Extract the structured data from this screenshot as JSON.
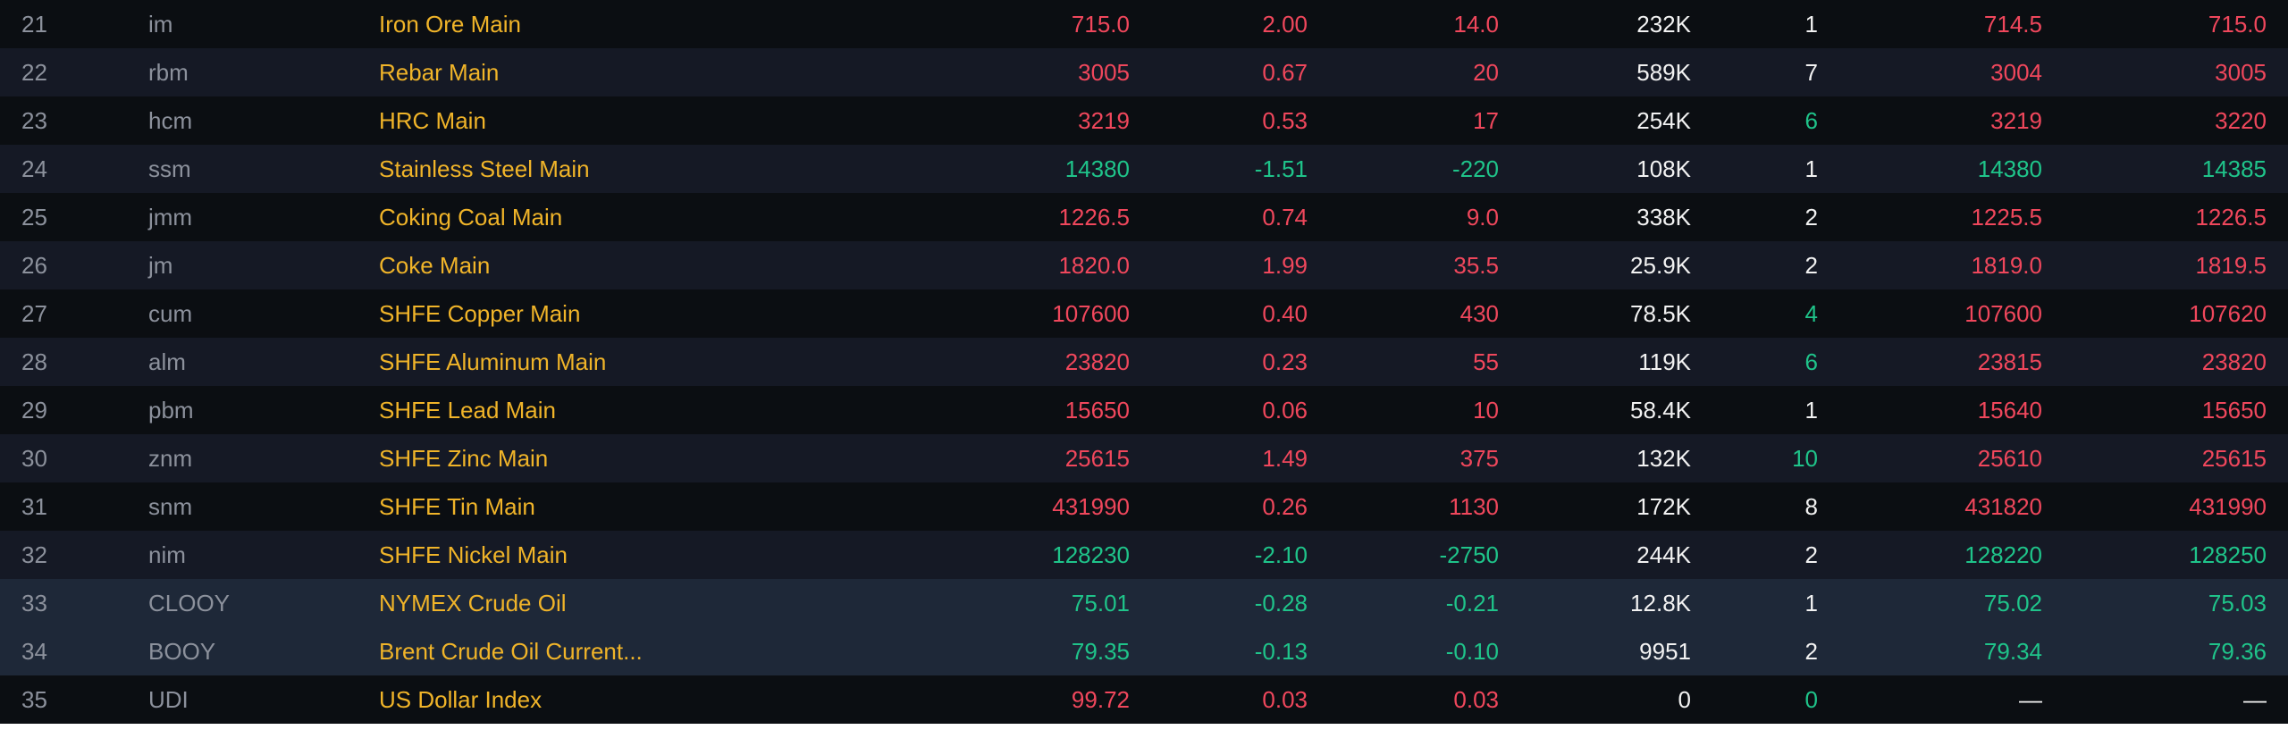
{
  "colors": {
    "up": "#f0475c",
    "down": "#1fc48a",
    "neutral": "#f2f2f2",
    "name": "#f0b429",
    "muted": "#8c919c",
    "row_odd": "#0b0e12",
    "row_even": "#151925",
    "row_highlight": "#1e2838"
  },
  "rows": [
    {
      "idx": "21",
      "code": "im",
      "name": "Iron Ore Main",
      "last": "715.0",
      "pct": "-",
      "pct_v": "2.00",
      "chg": "14.0",
      "vol": "232K",
      "cur": "1",
      "bid": "714.5",
      "ask": "715.0",
      "dir": "up",
      "cur_dir": "flat",
      "bg": "odd"
    },
    {
      "idx": "22",
      "code": "rbm",
      "name": "Rebar Main",
      "last": "3005",
      "pct_v": "0.67",
      "chg": "20",
      "vol": "589K",
      "cur": "7",
      "bid": "3004",
      "ask": "3005",
      "dir": "up",
      "cur_dir": "flat",
      "bg": "even"
    },
    {
      "idx": "23",
      "code": "hcm",
      "name": "HRC Main",
      "last": "3219",
      "pct_v": "0.53",
      "chg": "17",
      "vol": "254K",
      "cur": "6",
      "bid": "3219",
      "ask": "3220",
      "dir": "up",
      "cur_dir": "down",
      "bg": "odd"
    },
    {
      "idx": "24",
      "code": "ssm",
      "name": "Stainless Steel Main",
      "last": "14380",
      "pct_v": "-1.51",
      "chg": "-220",
      "vol": "108K",
      "cur": "1",
      "bid": "14380",
      "ask": "14385",
      "dir": "down",
      "cur_dir": "flat",
      "bg": "even"
    },
    {
      "idx": "25",
      "code": "jmm",
      "name": "Coking Coal Main",
      "last": "1226.5",
      "pct_v": "0.74",
      "chg": "9.0",
      "vol": "338K",
      "cur": "2",
      "bid": "1225.5",
      "ask": "1226.5",
      "dir": "up",
      "cur_dir": "flat",
      "bg": "odd"
    },
    {
      "idx": "26",
      "code": "jm",
      "name": "Coke Main",
      "last": "1820.0",
      "pct_v": "1.99",
      "chg": "35.5",
      "vol": "25.9K",
      "cur": "2",
      "bid": "1819.0",
      "ask": "1819.5",
      "dir": "up",
      "cur_dir": "flat",
      "bg": "even"
    },
    {
      "idx": "27",
      "code": "cum",
      "name": "SHFE Copper Main",
      "last": "107600",
      "pct_v": "0.40",
      "chg": "430",
      "vol": "78.5K",
      "cur": "4",
      "bid": "107600",
      "ask": "107620",
      "dir": "up",
      "cur_dir": "down",
      "bg": "odd"
    },
    {
      "idx": "28",
      "code": "alm",
      "name": "SHFE Aluminum Main",
      "last": "23820",
      "pct_v": "0.23",
      "chg": "55",
      "vol": "119K",
      "cur": "6",
      "bid": "23815",
      "ask": "23820",
      "dir": "up",
      "cur_dir": "down",
      "bg": "even"
    },
    {
      "idx": "29",
      "code": "pbm",
      "name": "SHFE Lead Main",
      "last": "15650",
      "pct_v": "0.06",
      "chg": "10",
      "vol": "58.4K",
      "cur": "1",
      "bid": "15640",
      "ask": "15650",
      "dir": "up",
      "cur_dir": "flat",
      "bg": "odd"
    },
    {
      "idx": "30",
      "code": "znm",
      "name": "SHFE Zinc Main",
      "last": "25615",
      "pct_v": "1.49",
      "chg": "375",
      "vol": "132K",
      "cur": "10",
      "bid": "25610",
      "ask": "25615",
      "dir": "up",
      "cur_dir": "down",
      "bg": "even"
    },
    {
      "idx": "31",
      "code": "snm",
      "name": "SHFE Tin Main",
      "last": "431990",
      "pct_v": "0.26",
      "chg": "1130",
      "vol": "172K",
      "cur": "8",
      "bid": "431820",
      "ask": "431990",
      "dir": "up",
      "cur_dir": "flat",
      "bg": "odd"
    },
    {
      "idx": "32",
      "code": "nim",
      "name": "SHFE Nickel Main",
      "last": "128230",
      "pct_v": "-2.10",
      "chg": "-2750",
      "vol": "244K",
      "cur": "2",
      "bid": "128220",
      "ask": "128250",
      "dir": "down",
      "cur_dir": "flat",
      "bg": "even"
    },
    {
      "idx": "33",
      "code": "CLOOY",
      "name": "NYMEX Crude Oil",
      "last": "75.01",
      "pct_v": "-0.28",
      "chg": "-0.21",
      "vol": "12.8K",
      "cur": "1",
      "bid": "75.02",
      "ask": "75.03",
      "dir": "down",
      "cur_dir": "flat",
      "bg": "hl"
    },
    {
      "idx": "34",
      "code": "BOOY",
      "name": "Brent Crude Oil Current...",
      "last": "79.35",
      "pct_v": "-0.13",
      "chg": "-0.10",
      "vol": "9951",
      "cur": "2",
      "bid": "79.34",
      "ask": "79.36",
      "dir": "down",
      "cur_dir": "flat",
      "bg": "hl"
    },
    {
      "idx": "35",
      "code": "UDI",
      "name": "US Dollar Index",
      "last": "99.72",
      "pct_v": "0.03",
      "chg": "0.03",
      "vol": "0",
      "cur": "0",
      "bid": "—",
      "ask": "—",
      "dir": "up",
      "cur_dir": "down",
      "bid_dir": "flat",
      "bg": "odd"
    }
  ]
}
